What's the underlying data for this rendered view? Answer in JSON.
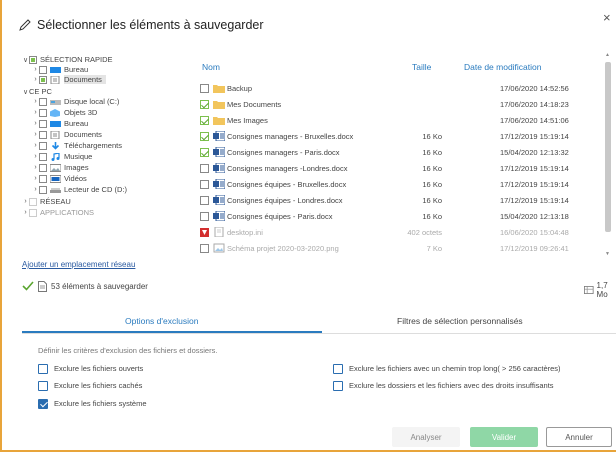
{
  "dialog": {
    "title": "Sélectionner les éléments à sauvegarder",
    "close": "×"
  },
  "tree": [
    {
      "label": "SÉLECTION RAPIDE",
      "chev": "∨",
      "icon": "",
      "check": "part",
      "muted": false,
      "selected": false
    },
    {
      "label": "Bureau",
      "chev": "›",
      "icon": "desktop-icon",
      "check": "empty",
      "muted": false,
      "selected": false
    },
    {
      "label": "Documents",
      "chev": "›",
      "icon": "documents-icon",
      "check": "part",
      "muted": false,
      "selected": true
    },
    {
      "label": "CE PC",
      "chev": "∨",
      "icon": "",
      "check": "none",
      "muted": false,
      "selected": false
    },
    {
      "label": "Disque local (C:)",
      "chev": "›",
      "icon": "disk-icon",
      "check": "empty",
      "muted": false,
      "selected": false
    },
    {
      "label": "Objets 3D",
      "chev": "›",
      "icon": "objects3d-icon",
      "check": "empty",
      "muted": false,
      "selected": false
    },
    {
      "label": "Bureau",
      "chev": "›",
      "icon": "desktop-icon",
      "check": "empty",
      "muted": false,
      "selected": false
    },
    {
      "label": "Documents",
      "chev": "›",
      "icon": "documents-icon",
      "check": "empty",
      "muted": false,
      "selected": false
    },
    {
      "label": "Téléchargements",
      "chev": "›",
      "icon": "download-icon",
      "check": "empty",
      "muted": false,
      "selected": false
    },
    {
      "label": "Musique",
      "chev": "›",
      "icon": "music-icon",
      "check": "empty",
      "muted": false,
      "selected": false
    },
    {
      "label": "Images",
      "chev": "›",
      "icon": "images-icon",
      "check": "empty",
      "muted": false,
      "selected": false
    },
    {
      "label": "Vidéos",
      "chev": "›",
      "icon": "video-icon",
      "check": "empty",
      "muted": false,
      "selected": false
    },
    {
      "label": "Lecteur de CD (D:)",
      "chev": "›",
      "icon": "cd-drive-icon",
      "check": "empty",
      "muted": false,
      "selected": false
    },
    {
      "label": "RÉSEAU",
      "chev": "›",
      "icon": "",
      "check": "dim",
      "muted": false,
      "selected": false
    },
    {
      "label": "APPLICATIONS",
      "chev": "›",
      "icon": "",
      "check": "dim",
      "muted": true,
      "selected": false
    }
  ],
  "table": {
    "headers": {
      "name": "Nom",
      "size": "Taille",
      "date": "Date de modification"
    },
    "rows": [
      {
        "name": "Backup",
        "size": "",
        "date": "17/06/2020 14:52:56",
        "type": "folder",
        "checked": false,
        "gray": false
      },
      {
        "name": "Mes Documents",
        "size": "",
        "date": "17/06/2020 14:18:23",
        "type": "folder",
        "checked": true,
        "gray": false
      },
      {
        "name": "Mes Images",
        "size": "",
        "date": "17/06/2020 14:51:06",
        "type": "folder",
        "checked": true,
        "gray": false
      },
      {
        "name": "Consignes managers - Bruxelles.docx",
        "size": "16 Ko",
        "date": "17/12/2019 15:19:14",
        "type": "word",
        "checked": true,
        "gray": false
      },
      {
        "name": "Consignes managers - Paris.docx",
        "size": "16 Ko",
        "date": "15/04/2020 12:13:32",
        "type": "word",
        "checked": true,
        "gray": false
      },
      {
        "name": "Consignes managers -Londres.docx",
        "size": "16 Ko",
        "date": "17/12/2019 15:19:14",
        "type": "word",
        "checked": false,
        "gray": false
      },
      {
        "name": "Consignes équipes - Bruxelles.docx",
        "size": "16 Ko",
        "date": "17/12/2019 15:19:14",
        "type": "word",
        "checked": false,
        "gray": false
      },
      {
        "name": "Consignes équipes - Londres.docx",
        "size": "16 Ko",
        "date": "17/12/2019 15:19:14",
        "type": "word",
        "checked": false,
        "gray": false
      },
      {
        "name": "Consignes équipes - Paris.docx",
        "size": "16 Ko",
        "date": "15/04/2020 12:13:18",
        "type": "word",
        "checked": false,
        "gray": false
      },
      {
        "name": "desktop.ini",
        "size": "402 octets",
        "date": "16/06/2020 15:04:48",
        "type": "ini",
        "checked": false,
        "gray": true,
        "blocked": true
      },
      {
        "name": "Schéma projet 2020-03-2020.png",
        "size": "7 Ko",
        "date": "17/12/2019 09:26:41",
        "type": "image",
        "checked": false,
        "gray": true
      }
    ]
  },
  "add_location": "Ajouter un emplacement réseau",
  "summary": {
    "text": "53 éléments à sauvegarder",
    "size": "1,7 Mo"
  },
  "tabs": [
    {
      "label": "Options d'exclusion",
      "active": true
    },
    {
      "label": "Filtres de sélection personnalisés",
      "active": false
    }
  ],
  "options": {
    "description": "Définir les critères d'exclusion des fichiers et dossiers.",
    "items": [
      {
        "label": "Exclure les fichiers ouverts",
        "checked": false
      },
      {
        "label": "Exclure les fichiers cachés",
        "checked": false
      },
      {
        "label": "Exclure les fichiers système",
        "checked": true
      },
      {
        "label": "Exclure les fichiers avec un chemin trop long( > 256 caractères)",
        "checked": false
      },
      {
        "label": "Exclure les dossiers et les fichiers avec des droits insuffisants",
        "checked": false
      }
    ]
  },
  "buttons": {
    "analyser": "Analyser",
    "valider": "Valider",
    "annuler": "Annuler"
  },
  "colors": {
    "accent": "#2a7bbf",
    "green": "#7cc04d",
    "valider": "#8fd7a6",
    "frame": "#e8a43a"
  }
}
